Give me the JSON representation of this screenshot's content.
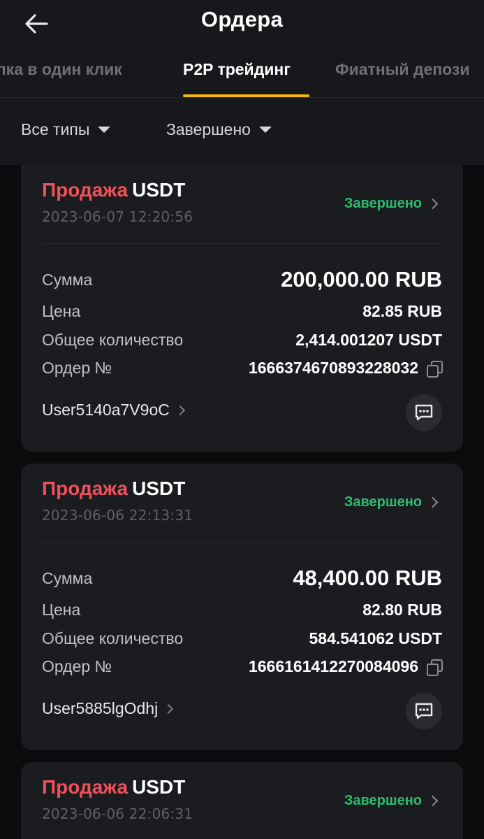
{
  "header": {
    "title": "Ордера",
    "back_icon": "arrow-left-icon"
  },
  "tabs": [
    {
      "label": "упка в один клик",
      "active": false
    },
    {
      "label": "P2P трейдинг",
      "active": true
    },
    {
      "label": "Фиатный депози",
      "active": false
    }
  ],
  "filters": {
    "type_label": "Все типы",
    "status_label": "Завершено"
  },
  "colors": {
    "accent": "#f0b90b",
    "sell": "#f0505a",
    "completed": "#2ebd6f"
  },
  "labels": {
    "amount": "Сумма",
    "price": "Цена",
    "total_quantity": "Общее количество",
    "order_no": "Ордер №"
  },
  "orders": [
    {
      "side": "Продажа",
      "asset": "USDT",
      "date": "2023-06-07 12:20:56",
      "status": "Завершено",
      "amount": "200,000.00 RUB",
      "price": "82.85 RUB",
      "quantity": "2,414.001207 USDT",
      "order_no": "1666374670893228032",
      "user": "User5140a7V9oC"
    },
    {
      "side": "Продажа",
      "asset": "USDT",
      "date": "2023-06-06 22:13:31",
      "status": "Завершено",
      "amount": "48,400.00 RUB",
      "price": "82.80 RUB",
      "quantity": "584.541062 USDT",
      "order_no": "1666161412270084096",
      "user": "User5885lgOdhj"
    },
    {
      "side": "Продажа",
      "asset": "USDT",
      "date": "2023-06-06 22:06:31",
      "status": "Завершено"
    }
  ]
}
